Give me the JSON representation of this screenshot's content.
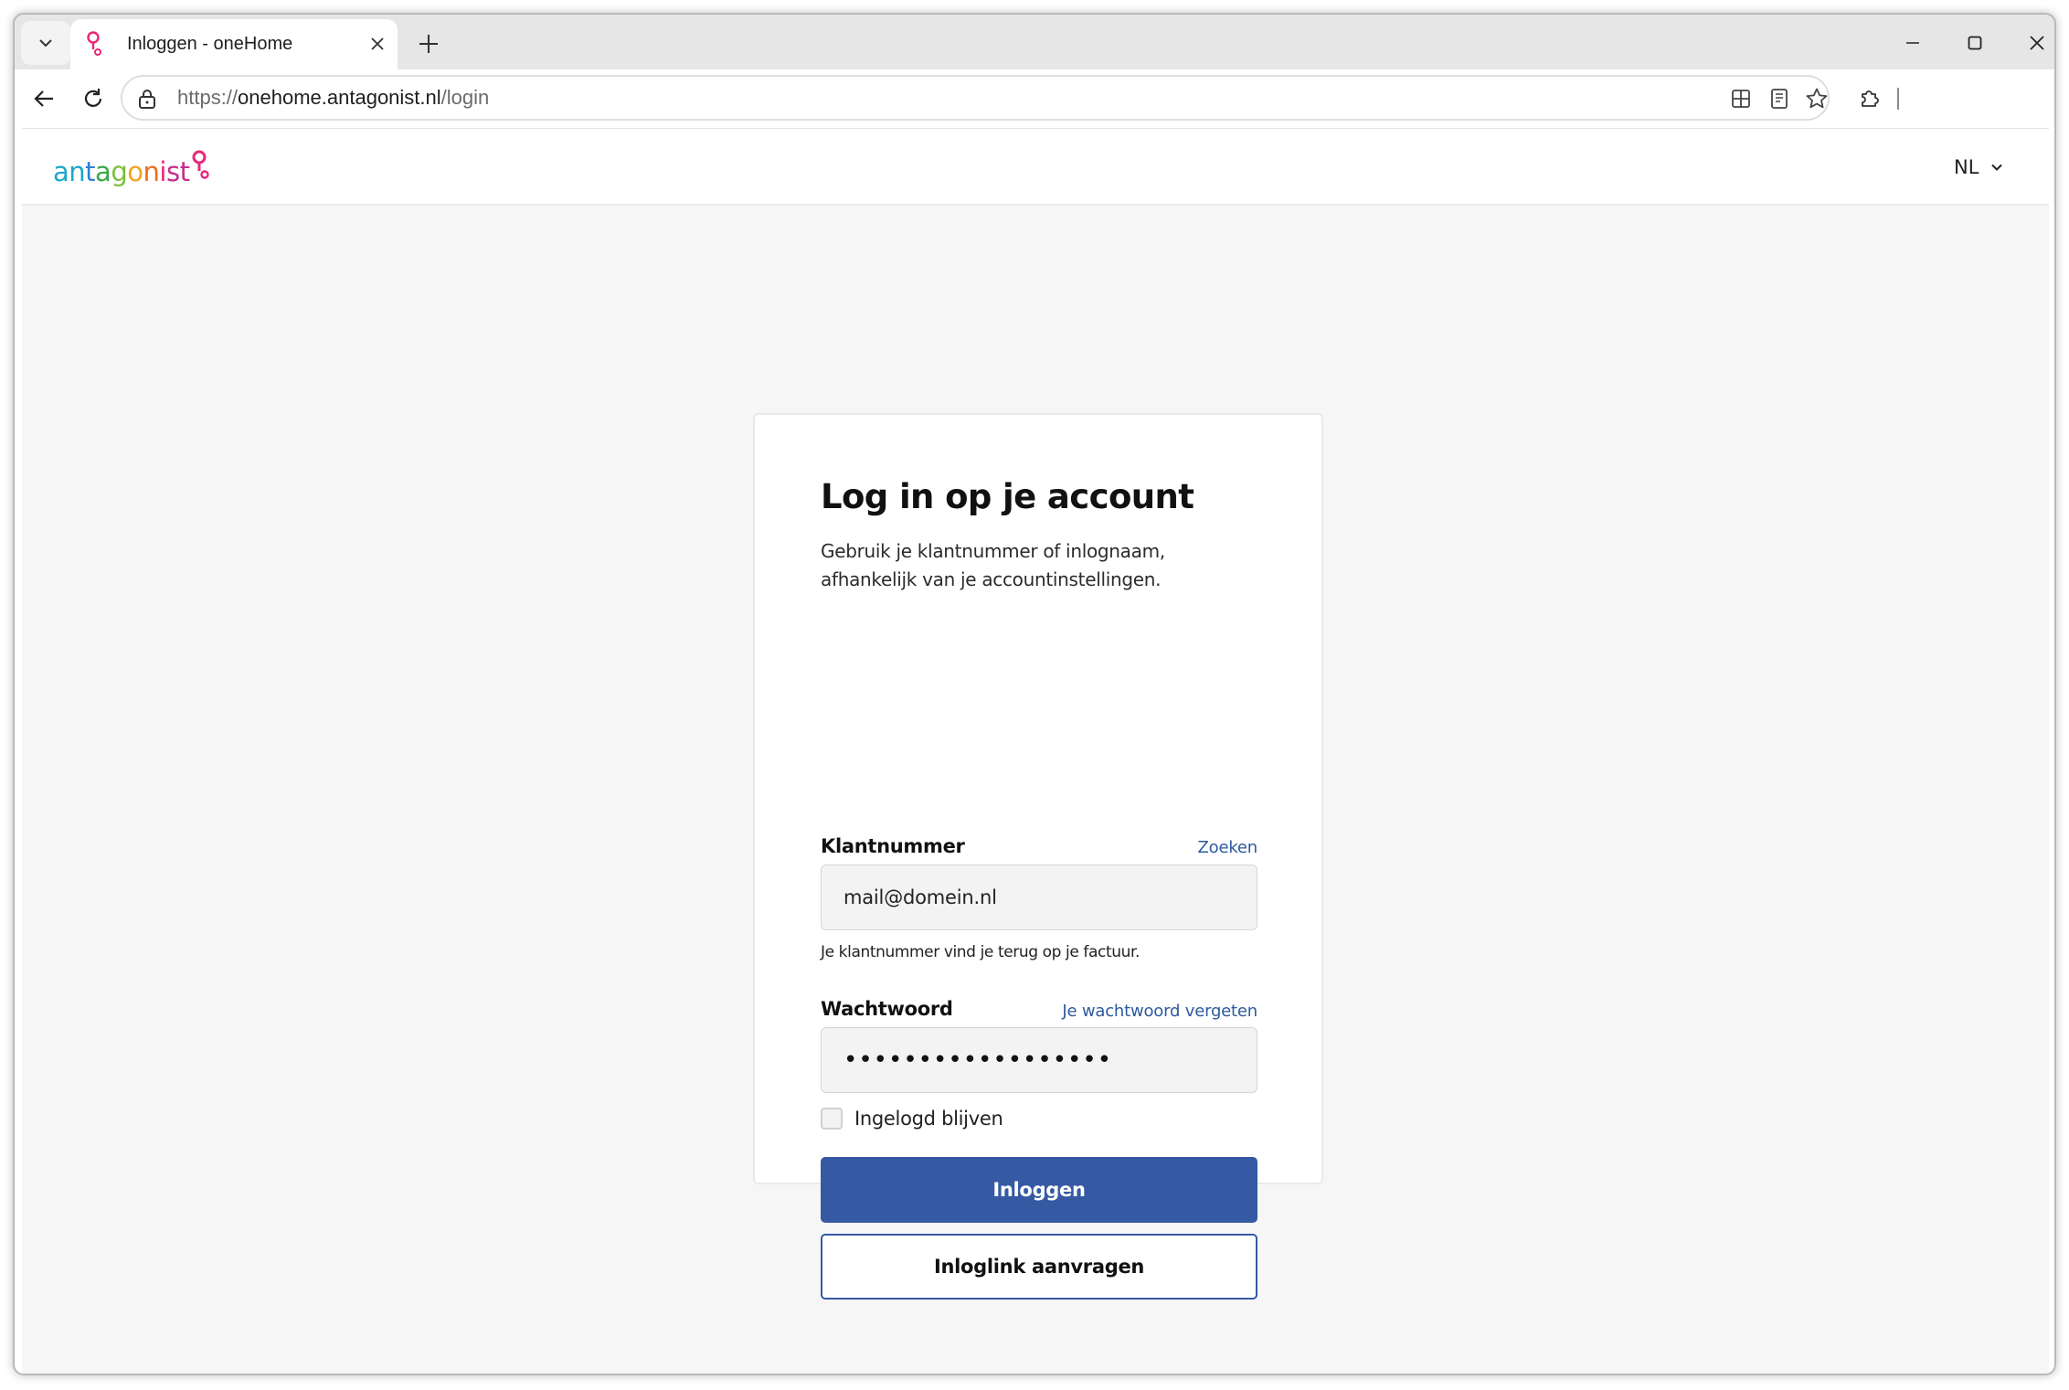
{
  "browser": {
    "tab": {
      "title": "Inloggen - oneHome"
    },
    "address_bar": {
      "scheme": "https://",
      "host": "onehome.antagonist.nl",
      "path": "/login"
    }
  },
  "site": {
    "logo": {
      "letters": [
        "a",
        "n",
        "t",
        "a",
        "g",
        "o",
        "n",
        "i",
        "s",
        "t"
      ],
      "colors": [
        "#1aa7c9",
        "#1aa7c9",
        "#2f7fd4",
        "#3aa848",
        "#7bbf3a",
        "#f2a51f",
        "#ef6c1f",
        "#e8287a",
        "#c72d8e",
        "#c72d8e"
      ],
      "mark_color": "#e8287a"
    },
    "language": "NL"
  },
  "login": {
    "title": "Log in op je account",
    "subtitle": "Gebruik je klantnummer of inlognaam, afhankelijk van je accountinstellingen.",
    "customer_number": {
      "label": "Klantnummer",
      "link": "Zoeken",
      "value": "mail@domein.nl",
      "hint": "Je klantnummer vind je terug op je factuur."
    },
    "password": {
      "label": "Wachtwoord",
      "link": "Je wachtwoord vergeten",
      "value": "••••••••••••••••••"
    },
    "remember_me": {
      "label": "Ingelogd blijven",
      "checked": false
    },
    "submit_label": "Inloggen",
    "magic_link_label": "Inloglink aanvragen"
  },
  "colors": {
    "primary": "#3559a3",
    "link": "#2d5a9e",
    "page_bg": "#f6f6f6"
  }
}
